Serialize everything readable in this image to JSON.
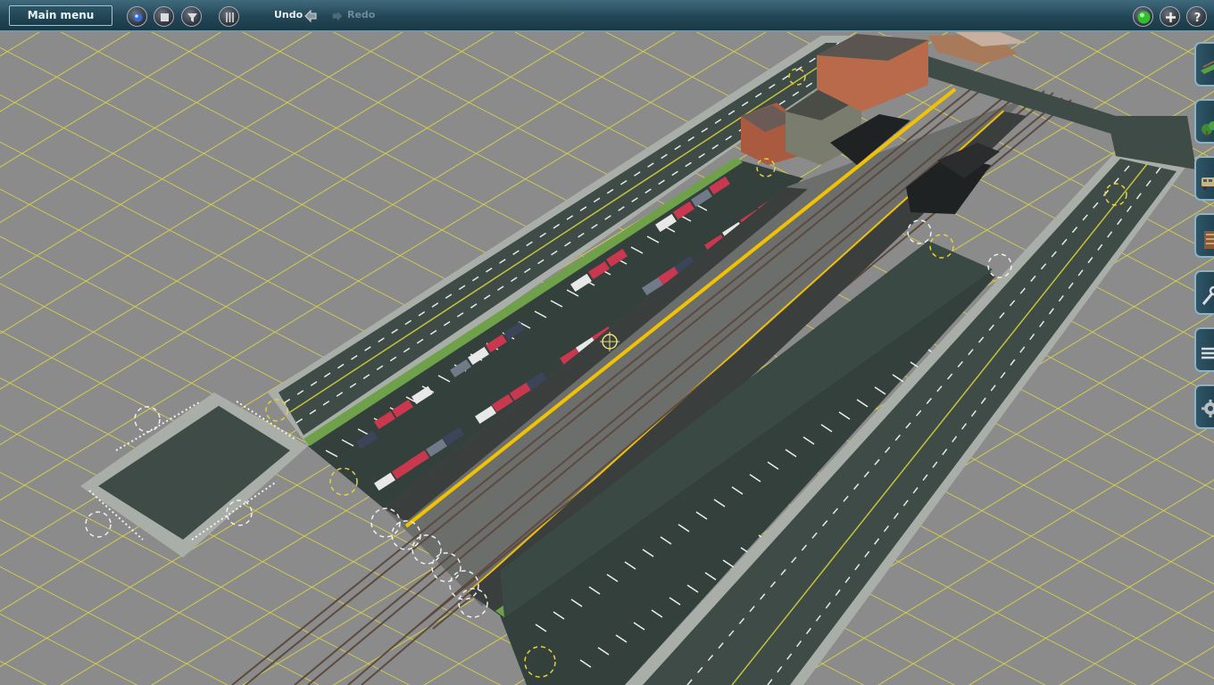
{
  "toolbar": {
    "main_menu_label": "Main menu",
    "undo_label": "Undo",
    "redo_label": "Redo"
  },
  "side_tabs": [
    "track-tool-icon",
    "scenery-tool-icon",
    "train-tool-icon",
    "building-tool-icon",
    "wrench-tool-icon",
    "layers-tool-icon",
    "gear-tool-icon"
  ],
  "icons": {
    "record": "record-icon",
    "stop": "stop-icon",
    "filter": "filter-icon",
    "grid": "grid-icon",
    "status": "status-light-icon",
    "zoom_in": "zoom-in-icon",
    "help": "help-icon"
  },
  "colors": {
    "toolbar": "#234656",
    "grid_line": "#d8d24a",
    "ground": "#8c8c8c",
    "asphalt": "#3b4a44",
    "platform_stripe": "#f2c200"
  }
}
